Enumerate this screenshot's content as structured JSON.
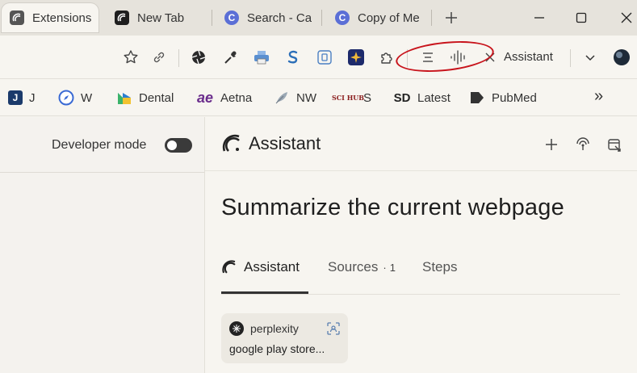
{
  "tabs": [
    {
      "label": "Extensions",
      "active": true
    },
    {
      "label": "New Tab",
      "active": false
    },
    {
      "label": "Search - Ca",
      "active": false
    },
    {
      "label": "Copy of Me",
      "active": false
    }
  ],
  "window_controls": {
    "minimize": "—",
    "maximize": "☐",
    "close": "✕"
  },
  "toolbar": {
    "assistant_label": "Assistant",
    "icons": [
      "star-icon",
      "link-icon",
      "aperture-icon",
      "eyedropper-icon",
      "printer-icon",
      "s-extension-icon",
      "screenshot-icon",
      "compass-extension-icon",
      "extensions-puzzle-icon",
      "menu-lines-icon",
      "voice-waveform-icon",
      "close-icon",
      "chevron-down-icon",
      "profile-avatar-icon"
    ]
  },
  "bookmarks": [
    {
      "label": "J"
    },
    {
      "label": "W"
    },
    {
      "label": "Dental"
    },
    {
      "label": "Aetna",
      "badge": "ae"
    },
    {
      "label": "NW"
    },
    {
      "label": "S",
      "badge": "SCI HUB"
    },
    {
      "label": "Latest",
      "badge": "SD"
    },
    {
      "label": "PubMed"
    }
  ],
  "bookmarks_more": "»",
  "extensions_page": {
    "developer_mode_label": "Developer mode",
    "developer_mode_on": true
  },
  "assistant": {
    "title": "Assistant",
    "question": "Summarize the current webpage",
    "tabs": {
      "assistant": "Assistant",
      "sources": "Sources",
      "sources_sep": "·",
      "sources_count": "1",
      "steps": "Steps"
    },
    "source": {
      "name": "perplexity",
      "snippet": "google play store..."
    }
  },
  "colors": {
    "annotation": "#c8141c",
    "background": "#f7f5f0",
    "tabstrip": "#e6e3dc"
  }
}
